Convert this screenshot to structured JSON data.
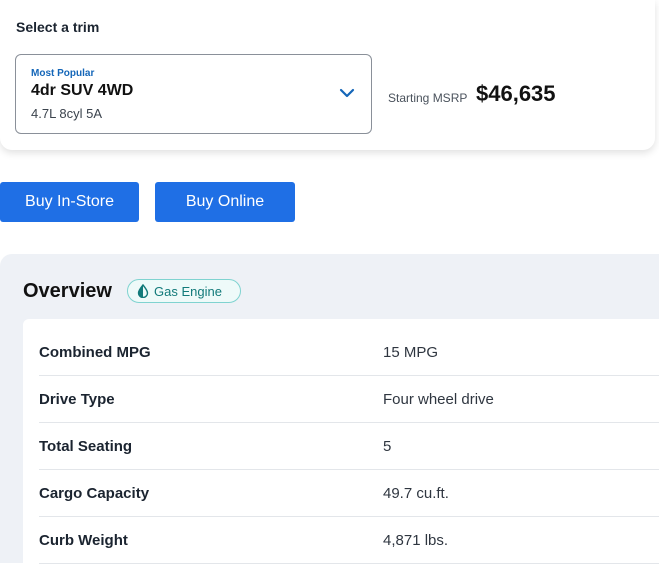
{
  "trim": {
    "heading": "Select a trim",
    "eyebrow": "Most Popular",
    "name": "4dr SUV 4WD",
    "engine": "4.7L 8cyl 5A",
    "msrp_label": "Starting MSRP",
    "msrp_value": "$46,635"
  },
  "actions": {
    "buy_in_store": "Buy In-Store",
    "buy_online": "Buy Online"
  },
  "overview": {
    "title": "Overview",
    "badge": "Gas Engine",
    "specs": [
      {
        "label": "Combined MPG",
        "value": "15 MPG"
      },
      {
        "label": "Drive Type",
        "value": "Four wheel drive"
      },
      {
        "label": "Total Seating",
        "value": "5"
      },
      {
        "label": "Cargo Capacity",
        "value": "49.7 cu.ft."
      },
      {
        "label": "Curb Weight",
        "value": "4,871 lbs."
      }
    ]
  },
  "colors": {
    "accent": "#1f6fe5",
    "eyebrow": "#1466b8",
    "badge_text": "#127a7a"
  },
  "icons": {
    "dropdown": "chevron-down-icon",
    "engine": "fuel-drop-icon"
  }
}
